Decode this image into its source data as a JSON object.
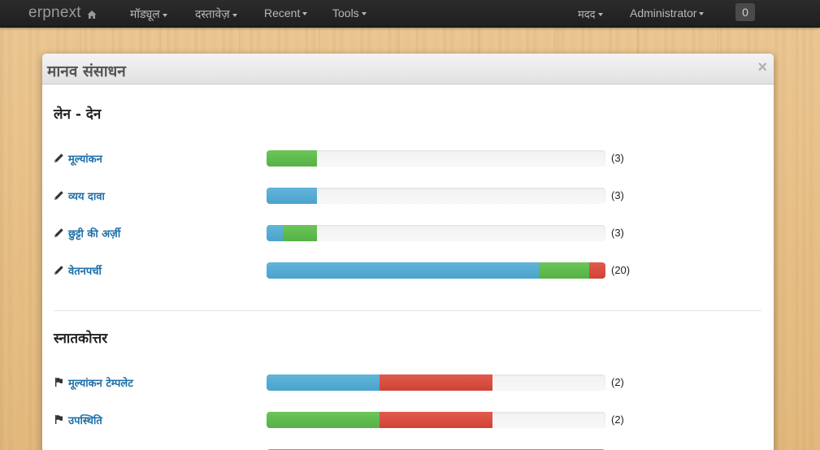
{
  "navbar": {
    "brand": "erpnext",
    "menus": [
      {
        "label": "मॉड्यूल"
      },
      {
        "label": "दस्तावेज़"
      },
      {
        "label": "Recent"
      },
      {
        "label": "Tools"
      }
    ],
    "help_label": "मदद",
    "user_label": "Administrator",
    "notification_count": "0"
  },
  "modal": {
    "title": "मानव संसाधन",
    "close": "×"
  },
  "sections": [
    {
      "title": "लेन - देन",
      "items": [
        {
          "label": "मूल्यांकन",
          "count": "(3)",
          "icon": "pencil-icon",
          "progress": [
            {
              "color": "green",
              "fraction": 0.148
            }
          ]
        },
        {
          "label": "व्यय दावा",
          "count": "(3)",
          "icon": "pencil-icon",
          "progress": [
            {
              "color": "blue",
              "fraction": 0.148
            }
          ]
        },
        {
          "label": "छुट्टी की अर्ज़ी",
          "count": "(3)",
          "icon": "pencil-icon",
          "progress": [
            {
              "color": "blue",
              "fraction": 0.048
            },
            {
              "color": "green",
              "fraction": 0.1
            }
          ]
        },
        {
          "label": "वेतनपर्ची",
          "count": "(20)",
          "icon": "pencil-icon",
          "progress": [
            {
              "color": "blue",
              "fraction": 0.803
            },
            {
              "color": "green",
              "fraction": 0.149
            },
            {
              "color": "red",
              "fraction": 0.048
            }
          ]
        }
      ]
    },
    {
      "title": "स्नातकोत्तर",
      "items": [
        {
          "label": "मूल्यांकन टेम्पलेट",
          "count": "(2)",
          "icon": "flag-icon",
          "progress": [
            {
              "color": "blue",
              "fraction": 0.333
            },
            {
              "color": "red",
              "fraction": 0.333
            }
          ]
        },
        {
          "label": "उपस्थिति",
          "count": "(2)",
          "icon": "flag-icon",
          "progress": [
            {
              "color": "green",
              "fraction": 0.333
            },
            {
              "color": "red",
              "fraction": 0.333
            }
          ]
        }
      ]
    }
  ],
  "colors": {
    "blue": "#4aa3cd",
    "green": "#55b245",
    "red": "#cf4335",
    "link": "#1e6fa8"
  }
}
